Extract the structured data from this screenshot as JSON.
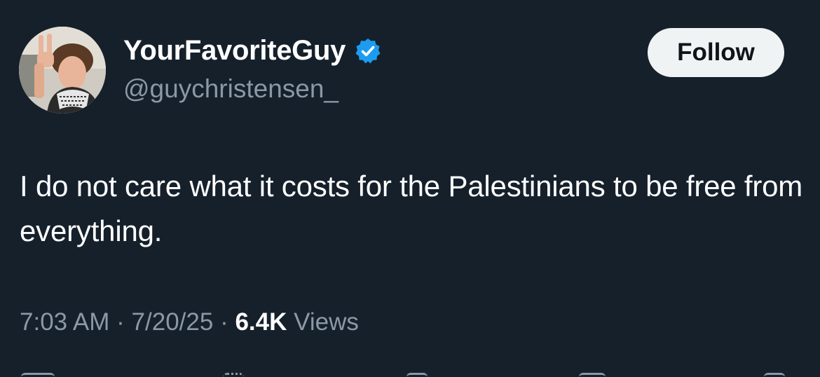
{
  "tweet": {
    "display_name": "YourFavoriteGuy",
    "handle": "@guychristensen_",
    "follow_label": "Follow",
    "text": "I do not care what it costs for the Palestinians to be free from everything.",
    "time": "7:03 AM",
    "separator": "·",
    "date": "7/20/25",
    "views_count": "6.4K",
    "views_label": "Views"
  },
  "icons": {
    "verified": "verified-badge-icon",
    "reply": "reply-icon",
    "retweet": "retweet-icon",
    "like": "like-icon",
    "bookmark": "bookmark-icon"
  },
  "colors": {
    "background": "#15202b",
    "text_primary": "#ffffff",
    "text_secondary": "#8b98a5",
    "verified": "#1d9bf0",
    "follow_bg": "#eff3f4",
    "follow_text": "#0f1419"
  }
}
